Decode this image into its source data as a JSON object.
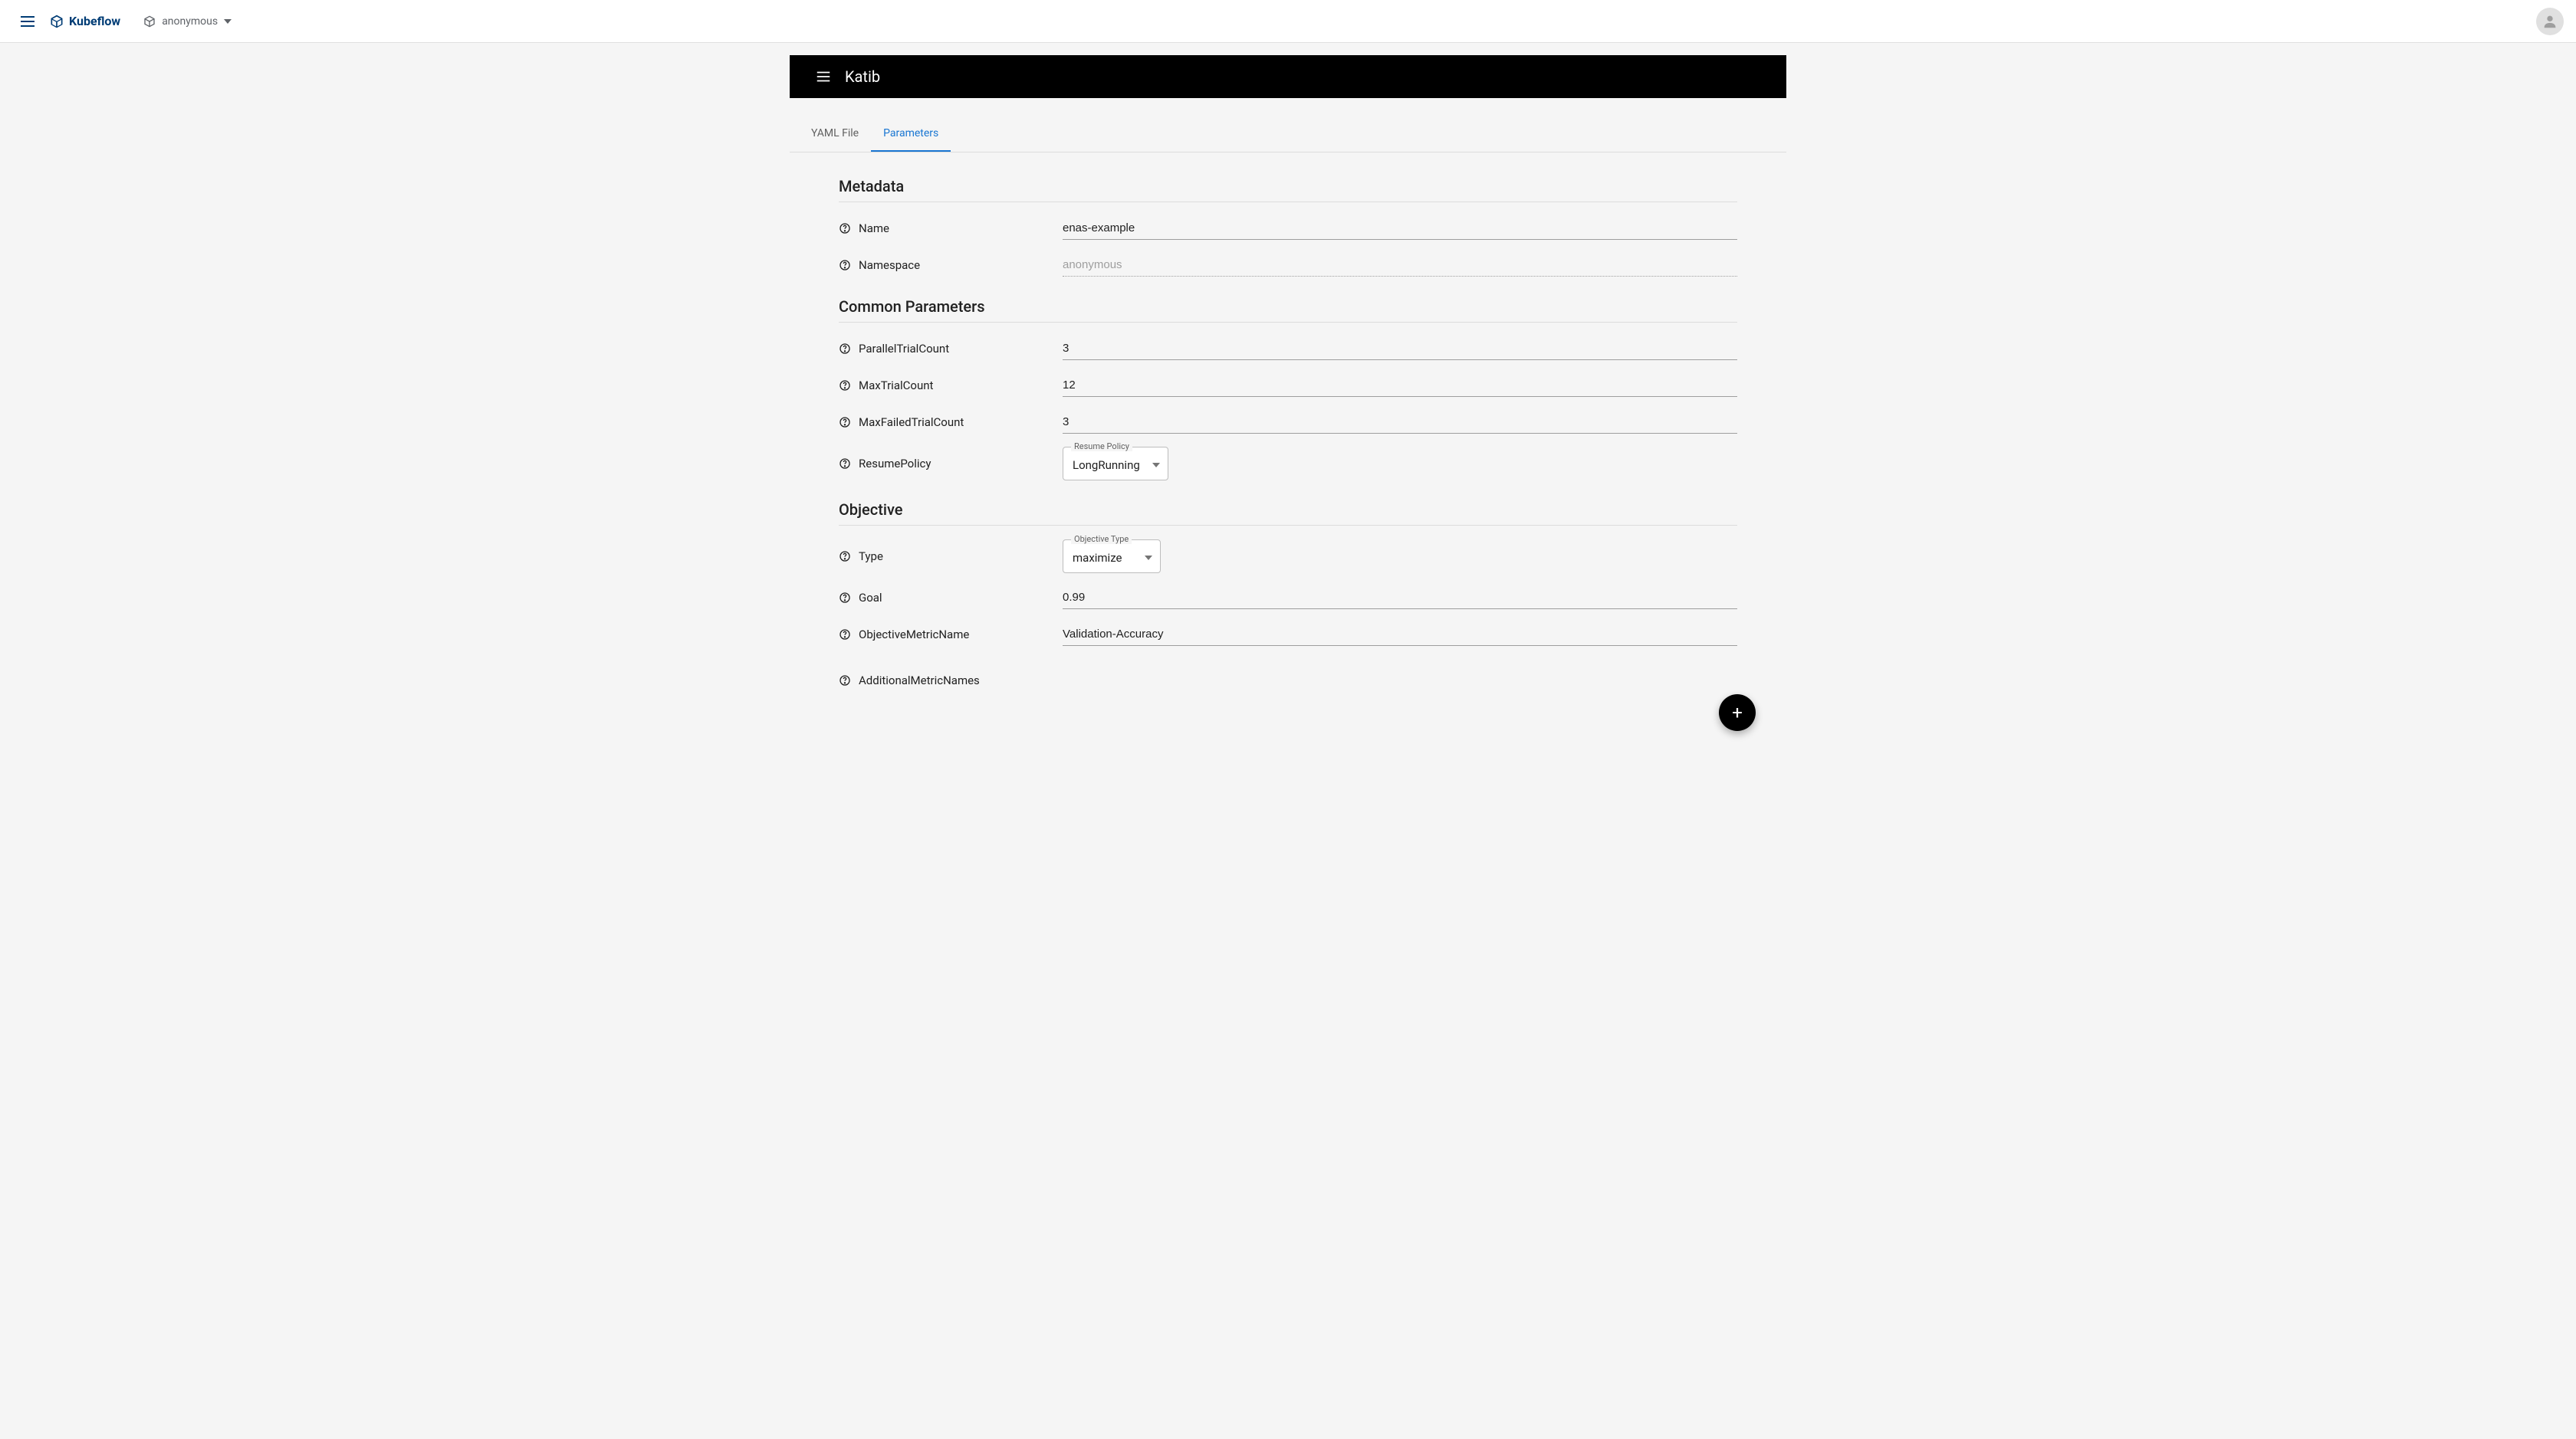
{
  "topbar": {
    "brand": "Kubeflow",
    "namespace": "anonymous"
  },
  "katib": {
    "title": "Katib"
  },
  "tabs": {
    "yaml": "YAML File",
    "parameters": "Parameters"
  },
  "sections": {
    "metadata": "Metadata",
    "common": "Common Parameters",
    "objective": "Objective"
  },
  "labels": {
    "name": "Name",
    "namespace": "Namespace",
    "parallelTrialCount": "ParallelTrialCount",
    "maxTrialCount": "MaxTrialCount",
    "maxFailedTrialCount": "MaxFailedTrialCount",
    "resumePolicy": "ResumePolicy",
    "type": "Type",
    "goal": "Goal",
    "objectiveMetricName": "ObjectiveMetricName",
    "additionalMetricNames": "AdditionalMetricNames",
    "resumePolicyFloat": "Resume Policy",
    "objectiveTypeFloat": "Objective Type"
  },
  "values": {
    "name": "enas-example",
    "namespace": "anonymous",
    "parallelTrialCount": "3",
    "maxTrialCount": "12",
    "maxFailedTrialCount": "3",
    "resumePolicy": "LongRunning",
    "objectiveType": "maximize",
    "goal": "0.99",
    "objectiveMetricName": "Validation-Accuracy"
  }
}
